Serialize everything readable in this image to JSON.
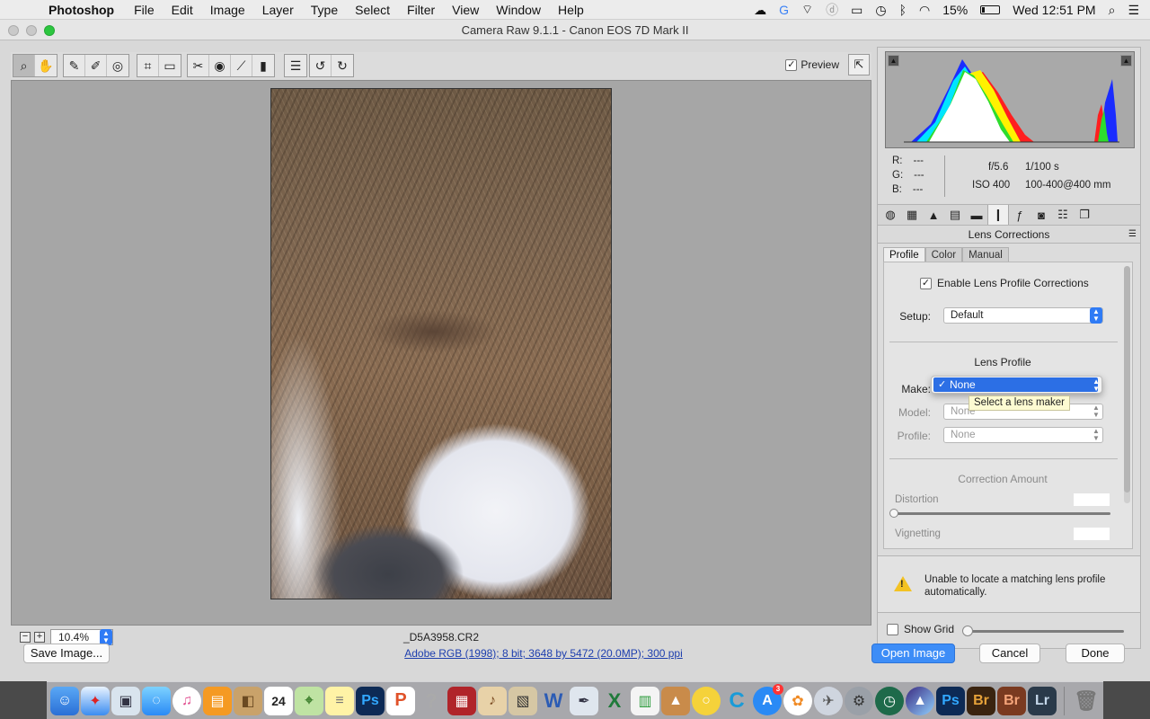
{
  "menubar": {
    "app_name": "Photoshop",
    "items": [
      "File",
      "Edit",
      "Image",
      "Layer",
      "Type",
      "Select",
      "Filter",
      "View",
      "Window",
      "Help"
    ],
    "battery": "15%",
    "clock": "Wed 12:51 PM"
  },
  "window": {
    "title": "Camera Raw 9.1.1  -  Canon EOS 7D Mark II"
  },
  "toolbar": {
    "tools": [
      "zoom-tool",
      "hand-tool",
      "white-balance-tool",
      "color-sampler-tool",
      "targeted-adjustment-tool",
      "crop-tool",
      "straighten-tool",
      "spot-removal-tool",
      "red-eye-removal-tool",
      "adjustment-brush-tool",
      "graduated-filter-tool",
      "radial-filter-tool",
      "preferences-button",
      "rotate-left-button",
      "rotate-right-button"
    ],
    "preview_label": "Preview",
    "preview_checked": true
  },
  "canvas": {
    "zoom_value": "10.4%",
    "filename": "_D5A3958.CR2"
  },
  "readout": {
    "r_label": "R:",
    "r_value": "---",
    "g_label": "G:",
    "g_value": "---",
    "b_label": "B:",
    "b_value": "---",
    "aperture": "f/5.6",
    "shutter": "1/100 s",
    "iso": "ISO 400",
    "lens": "100-400@400 mm"
  },
  "panel": {
    "section_title": "Lens Corrections",
    "tabs": [
      "Profile",
      "Color",
      "Manual"
    ],
    "active_tab": "Profile",
    "enable_label": "Enable Lens Profile Corrections",
    "enable_checked": true,
    "setup_label": "Setup:",
    "setup_value": "Default",
    "lens_profile_heading": "Lens Profile",
    "make_label": "Make:",
    "make_value": "None",
    "model_label": "Model:",
    "model_value": "None",
    "profile_label": "Profile:",
    "profile_value": "None",
    "correction_heading": "Correction Amount",
    "distortion_label": "Distortion",
    "vignetting_label": "Vignetting",
    "warning_text": "Unable to locate a matching lens profile automatically.",
    "show_grid_label": "Show Grid",
    "tooltip": "Select a lens maker"
  },
  "bottom": {
    "save_label": "Save Image...",
    "info_link": "Adobe RGB (1998); 8 bit; 3648 by 5472 (20.0MP); 300 ppi",
    "open_label": "Open Image",
    "cancel_label": "Cancel",
    "done_label": "Done"
  },
  "dock": {
    "calendar_day": "24",
    "notification_badge": "3",
    "apps": [
      "Finder",
      "Safari",
      "Preview",
      "Messages",
      "iTunes",
      "iBooks",
      "Contacts",
      "Calendar",
      "Maps",
      "Notes",
      "Photoshop",
      "PowerPoint",
      "Help",
      "Photo Booth",
      "GarageBand",
      "Image Capture",
      "Word",
      "Pen",
      "Excel",
      "Numbers",
      "Keynote",
      "Norton",
      "Chrome",
      "App Store",
      "Photos",
      "Launchpad",
      "System Preferences",
      "Time Machine",
      "Monterey",
      "Photoshop",
      "Bridge",
      "Bridge CC",
      "Lightroom",
      "Trash"
    ],
    "labels": {
      "ps": "Ps",
      "br": "Br",
      "lr": "Lr",
      "word": "W",
      "excel": "X"
    }
  }
}
